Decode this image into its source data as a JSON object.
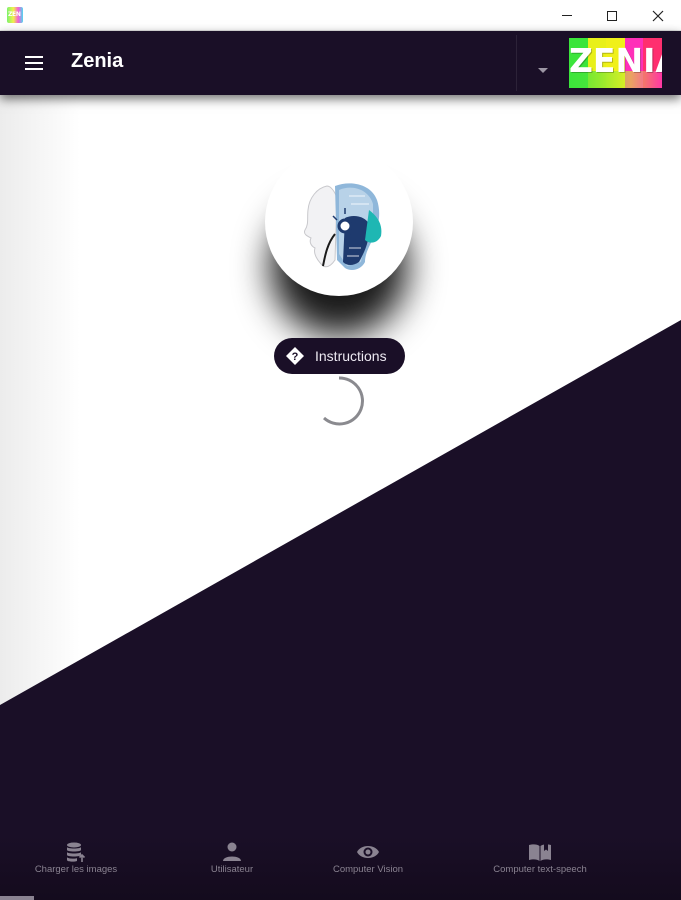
{
  "window": {
    "icon_name": "zenia-app-icon",
    "icon_text": "ZEN",
    "buttons": [
      "minimize-icon",
      "maximize-icon",
      "close-icon"
    ]
  },
  "appbar": {
    "title": "Zenia",
    "menu_icon": "hamburger-menu-icon",
    "dropdown_icon": "caret-down-icon",
    "logo_text": "ZENIA",
    "logo_colors": [
      "#3be53b",
      "#e8f01a",
      "#f0f01a",
      "#ff2fb9",
      "#ff2f6f"
    ]
  },
  "main": {
    "avatar_icon": "robot-head-icon",
    "instructions_label": "Instructions",
    "instructions_icon": "help-diamond-icon",
    "loading_icon": "loading-spinner-icon"
  },
  "bottom_nav": {
    "items": [
      {
        "label": "Charger les images",
        "icon": "database-upload-icon"
      },
      {
        "label": "Utilisateur",
        "icon": "person-icon"
      },
      {
        "label": "Computer Vision",
        "icon": "eye-icon"
      },
      {
        "label": "Computer text-speech",
        "icon": "book-open-icon"
      }
    ]
  },
  "colors": {
    "primary_dark": "#1a0f27",
    "background": "#ffffff",
    "nav_label": "#8a8391"
  }
}
